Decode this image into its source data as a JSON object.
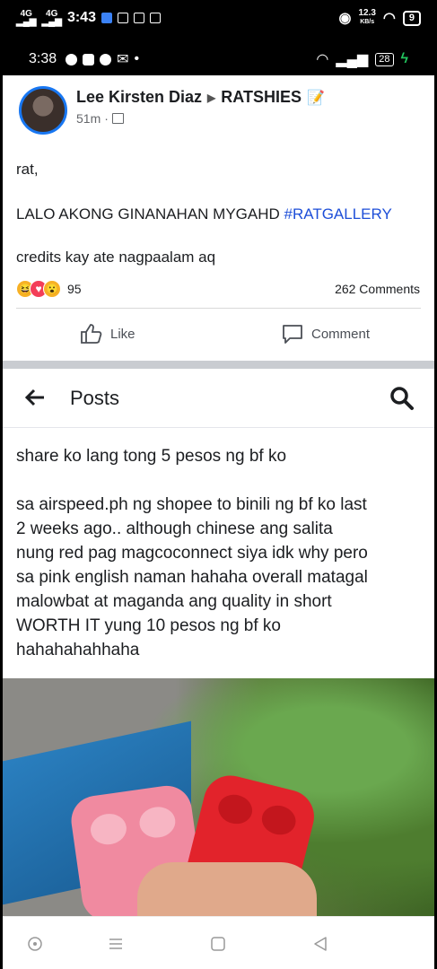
{
  "outer_status": {
    "signal_1": "4G",
    "signal_2": "4G",
    "time": "3:43",
    "net_speed_value": "12.3",
    "net_speed_unit": "KB/s",
    "battery": "9"
  },
  "inner_status": {
    "time": "3:38",
    "battery": "28"
  },
  "post": {
    "author": "Lee Kirsten Diaz",
    "group": "RATSHIES",
    "group_emoji": "📝",
    "time_ago": "51m",
    "line1": "rat,",
    "line2_text": "LALO AKONG GINANAHAN MYGAHD ",
    "hashtag": "#RATGALLERY",
    "line3": "credits kay ate nagpaalam aq",
    "reaction_count": "95",
    "comments_count": "262 Comments",
    "like_label": "Like",
    "comment_label": "Comment"
  },
  "posts_page": {
    "title": "Posts",
    "paragraph1": "share ko lang tong 5 pesos ng bf ko",
    "paragraph2_lines": [
      "sa airspeed.ph ng shopee to binili ng bf ko last",
      "2 weeks ago.. although chinese ang salita",
      "nung red pag magcoconnect siya idk why pero",
      "sa pink english naman hahaha overall matagal",
      "malowbat at maganda ang quality in short",
      "WORTH IT yung 10 pesos ng bf ko",
      "hahahahahhaha"
    ]
  },
  "icons": {
    "back": "arrow-left-icon",
    "search": "search-icon",
    "like": "thumbs-up-icon",
    "comment": "comment-bubble-icon",
    "nav_recent": "circle-dot-icon",
    "nav_menu": "menu-lines-icon",
    "nav_home": "square-icon",
    "nav_back": "triangle-back-icon"
  },
  "colors": {
    "link": "#1d4ed8",
    "avatar_ring": "#1877f2",
    "love": "#f33e58",
    "haha": "#f7b125"
  }
}
